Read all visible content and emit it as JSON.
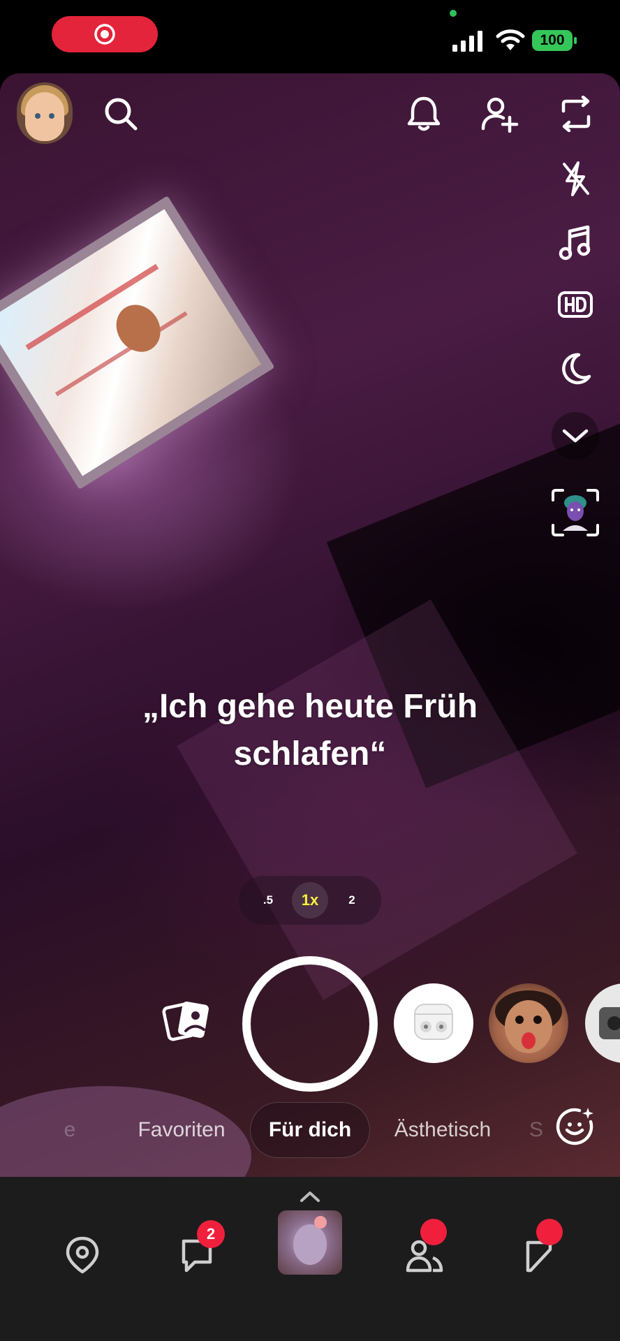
{
  "status_bar": {
    "battery": "100"
  },
  "caption": {
    "line1": "„Ich gehe heute Früh",
    "line2": "schlafen“"
  },
  "zoom": {
    "options": [
      ".5",
      "1x",
      "2"
    ],
    "selected": "1x"
  },
  "tabs": [
    {
      "label": "Favoriten"
    },
    {
      "label": "Für dich"
    },
    {
      "label": "Ästhetisch"
    }
  ],
  "nav": {
    "chat_badge": "2"
  },
  "colors": {
    "status_pill": "#e3243a",
    "battery": "#35c659",
    "badge": "#f0203c",
    "zoom_active": "#f5f03a"
  }
}
